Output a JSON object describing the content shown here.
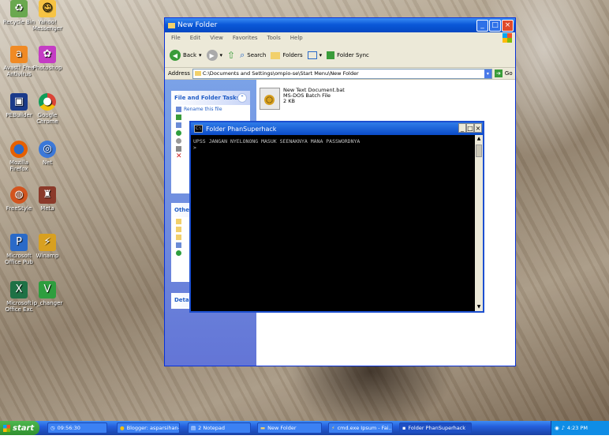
{
  "desktop": {
    "icons": [
      {
        "label": "Recycle Bin",
        "icon": "recycle-bin-icon",
        "color": "#6aa84f"
      },
      {
        "label": "Yahoo! Messenger",
        "icon": "yahoo-messenger-icon",
        "color": "#f6c343"
      },
      {
        "label": "Avast! Free Antivirus",
        "icon": "avast-icon",
        "color": "#f08a24"
      },
      {
        "label": "Photoshop",
        "icon": "photoshop-icon",
        "color": "#c43cc4"
      },
      {
        "label": "PEBuilder",
        "icon": "pebuilder-icon",
        "color": "#1a3a8a"
      },
      {
        "label": "Google Chrome",
        "icon": "chrome-icon",
        "color": "#db4437"
      },
      {
        "label": "Mozilla Firefox",
        "icon": "firefox-icon",
        "color": "#e66000"
      },
      {
        "label": "Net",
        "icon": "network-icon",
        "color": "#3b78d8"
      },
      {
        "label": "FreeStyle",
        "icon": "basketball-icon",
        "color": "#d2541e"
      },
      {
        "label": "Meta",
        "icon": "game-icon",
        "color": "#8b3a2a"
      },
      {
        "label": "Microsoft Office Pub",
        "icon": "publisher-icon",
        "color": "#2a6ac8"
      },
      {
        "label": "Winamp",
        "icon": "winamp-icon",
        "color": "#d8a020"
      },
      {
        "label": "Microsoft Office Exc",
        "icon": "excel-icon",
        "color": "#1e7145"
      },
      {
        "label": "ip_changer",
        "icon": "v-icon",
        "color": "#2e9e3e"
      }
    ]
  },
  "explorer": {
    "title": "New Folder",
    "menu": [
      "File",
      "Edit",
      "View",
      "Favorites",
      "Tools",
      "Help"
    ],
    "toolbar": {
      "back": "Back",
      "search": "Search",
      "folders": "Folders",
      "folder_sync": "Folder Sync"
    },
    "address_label": "Address",
    "address_value": "C:\\Documents and Settings\\ompio-se\\Start Menu\\New Folder",
    "go_label": "Go",
    "tasks_title": "File and Folder Tasks",
    "tasks_first_item": "Rename this file",
    "other_title": "Other",
    "details_title": "Detai",
    "file": {
      "name": "New Text Document.bat",
      "type": "MS-DOS Batch File",
      "size": "2 KB"
    }
  },
  "cmd": {
    "title": "Folder PhanSuperhack",
    "line1": "UPSS JANGAN NYELONONG MASUK SEENAKNYA MANA PASSWORDNYA",
    "line2": ">"
  },
  "taskbar": {
    "start_label": "start",
    "tasks": [
      {
        "label": "09:56:30",
        "icon": "clock-icon"
      },
      {
        "label": "Blogger: asparsihan-...",
        "icon": "chrome-icon"
      },
      {
        "label": "2 Notepad",
        "icon": "notepad-icon"
      },
      {
        "label": "New Folder",
        "icon": "folder-icon"
      },
      {
        "label": "cmd.exe Ipsum - Fai...",
        "icon": "winamp-icon"
      },
      {
        "label": "Folder PhanSuperhack",
        "icon": "cmd-icon"
      }
    ],
    "clock": "4:23 PM"
  },
  "colors": {
    "xp_blue": "#0a58d8",
    "start_green": "#3a9c3a",
    "console_bg": "#000000",
    "console_text": "#c0c0c0"
  }
}
